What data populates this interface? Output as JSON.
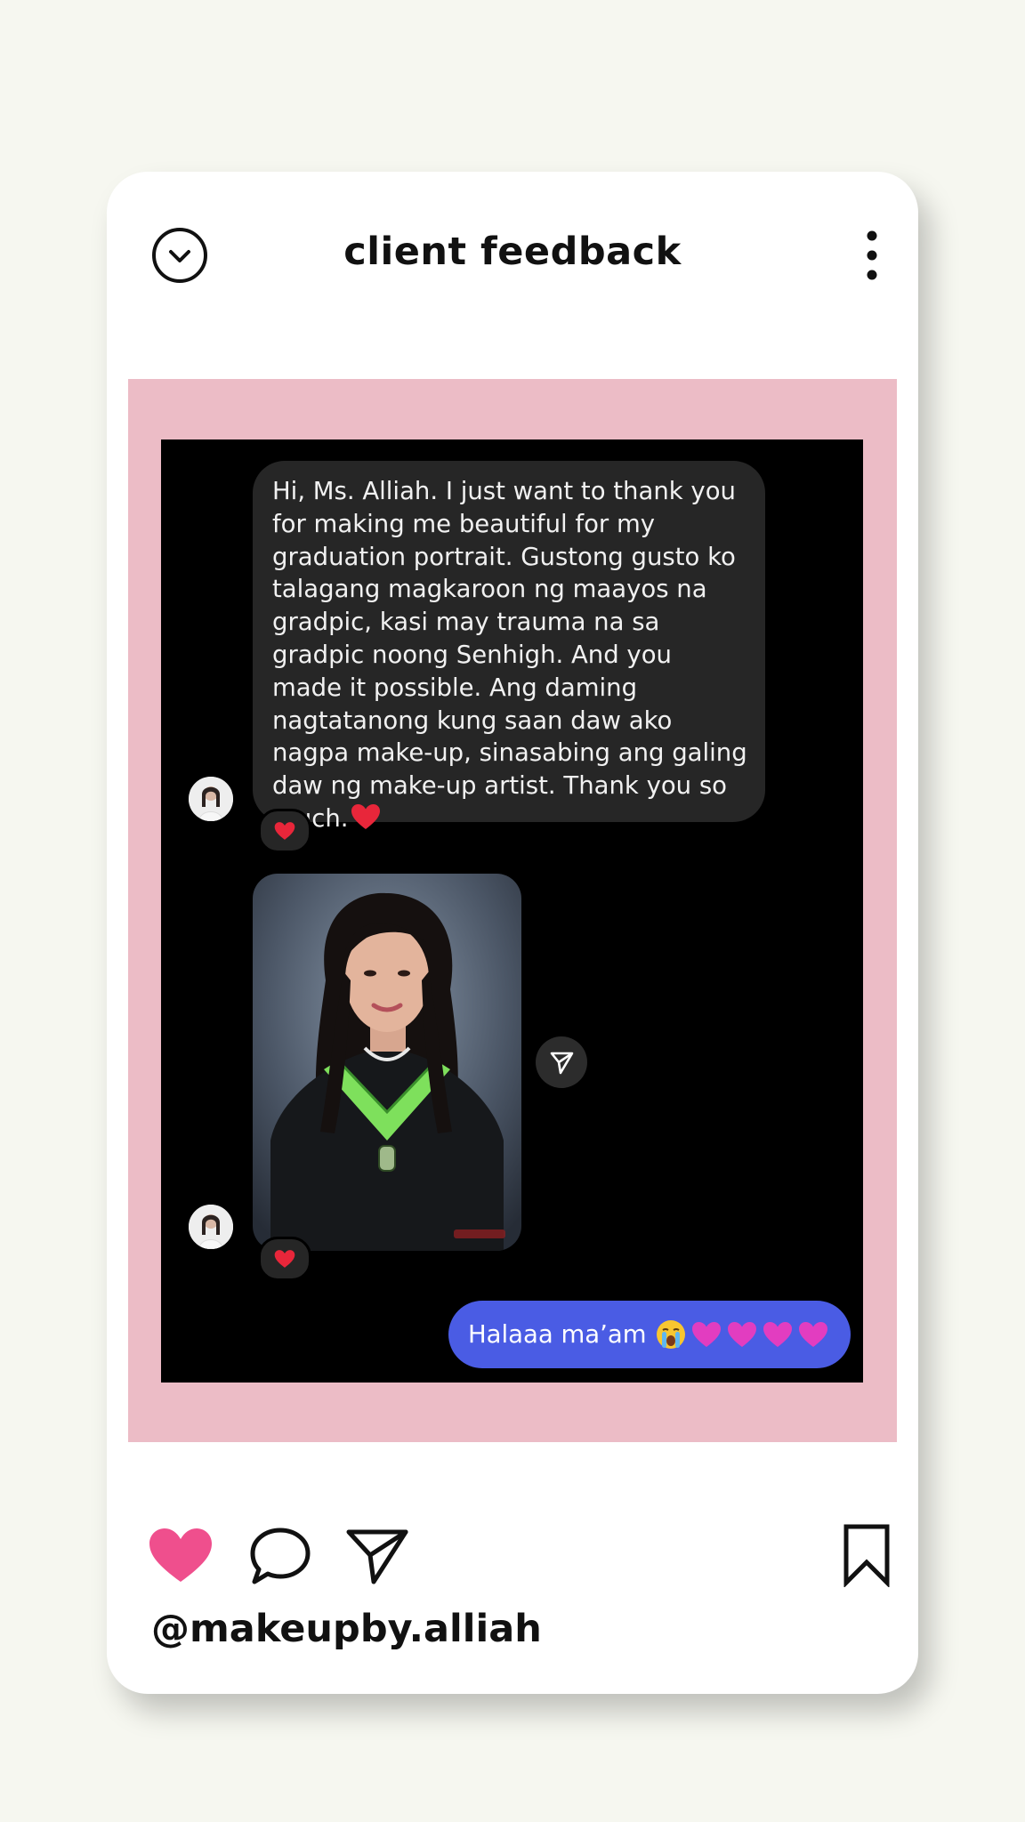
{
  "header": {
    "title": "client feedback"
  },
  "conversation": {
    "received_message": "Hi, Ms. Alliah. I just want to thank you for making me beautiful for my graduation portrait. Gustong gusto ko talagang magkaroon ng maayos na gradpic, kasi may trauma na sa gradpic noong Senhigh. And you made it possible. Ang daming nagtatanong kung saan daw ako nagpa make-up, sinasabing ang galing daw ng make-up artist. Thank you so much.",
    "received_message_emoji": "red-heart-emoji",
    "reactions": [
      "red-heart",
      "red-heart"
    ],
    "sent_message": "Halaaa ma’am",
    "sent_message_emojis": [
      "loudly-crying-face",
      "pink-heart",
      "pink-heart",
      "pink-heart",
      "pink-heart"
    ]
  },
  "footer": {
    "username": "@makeupby.alliah",
    "like_state": "liked"
  },
  "colors": {
    "page_background": "#f6f7f0",
    "card_background": "#ffffff",
    "pink_frame": "#ecbcc6",
    "received_bubble": "#262626",
    "sent_bubble": "#4a5ce4",
    "like_heart": "#ef4f8d",
    "reaction_heart": "#e8263a",
    "emoji_heart": "#e23dc0"
  }
}
